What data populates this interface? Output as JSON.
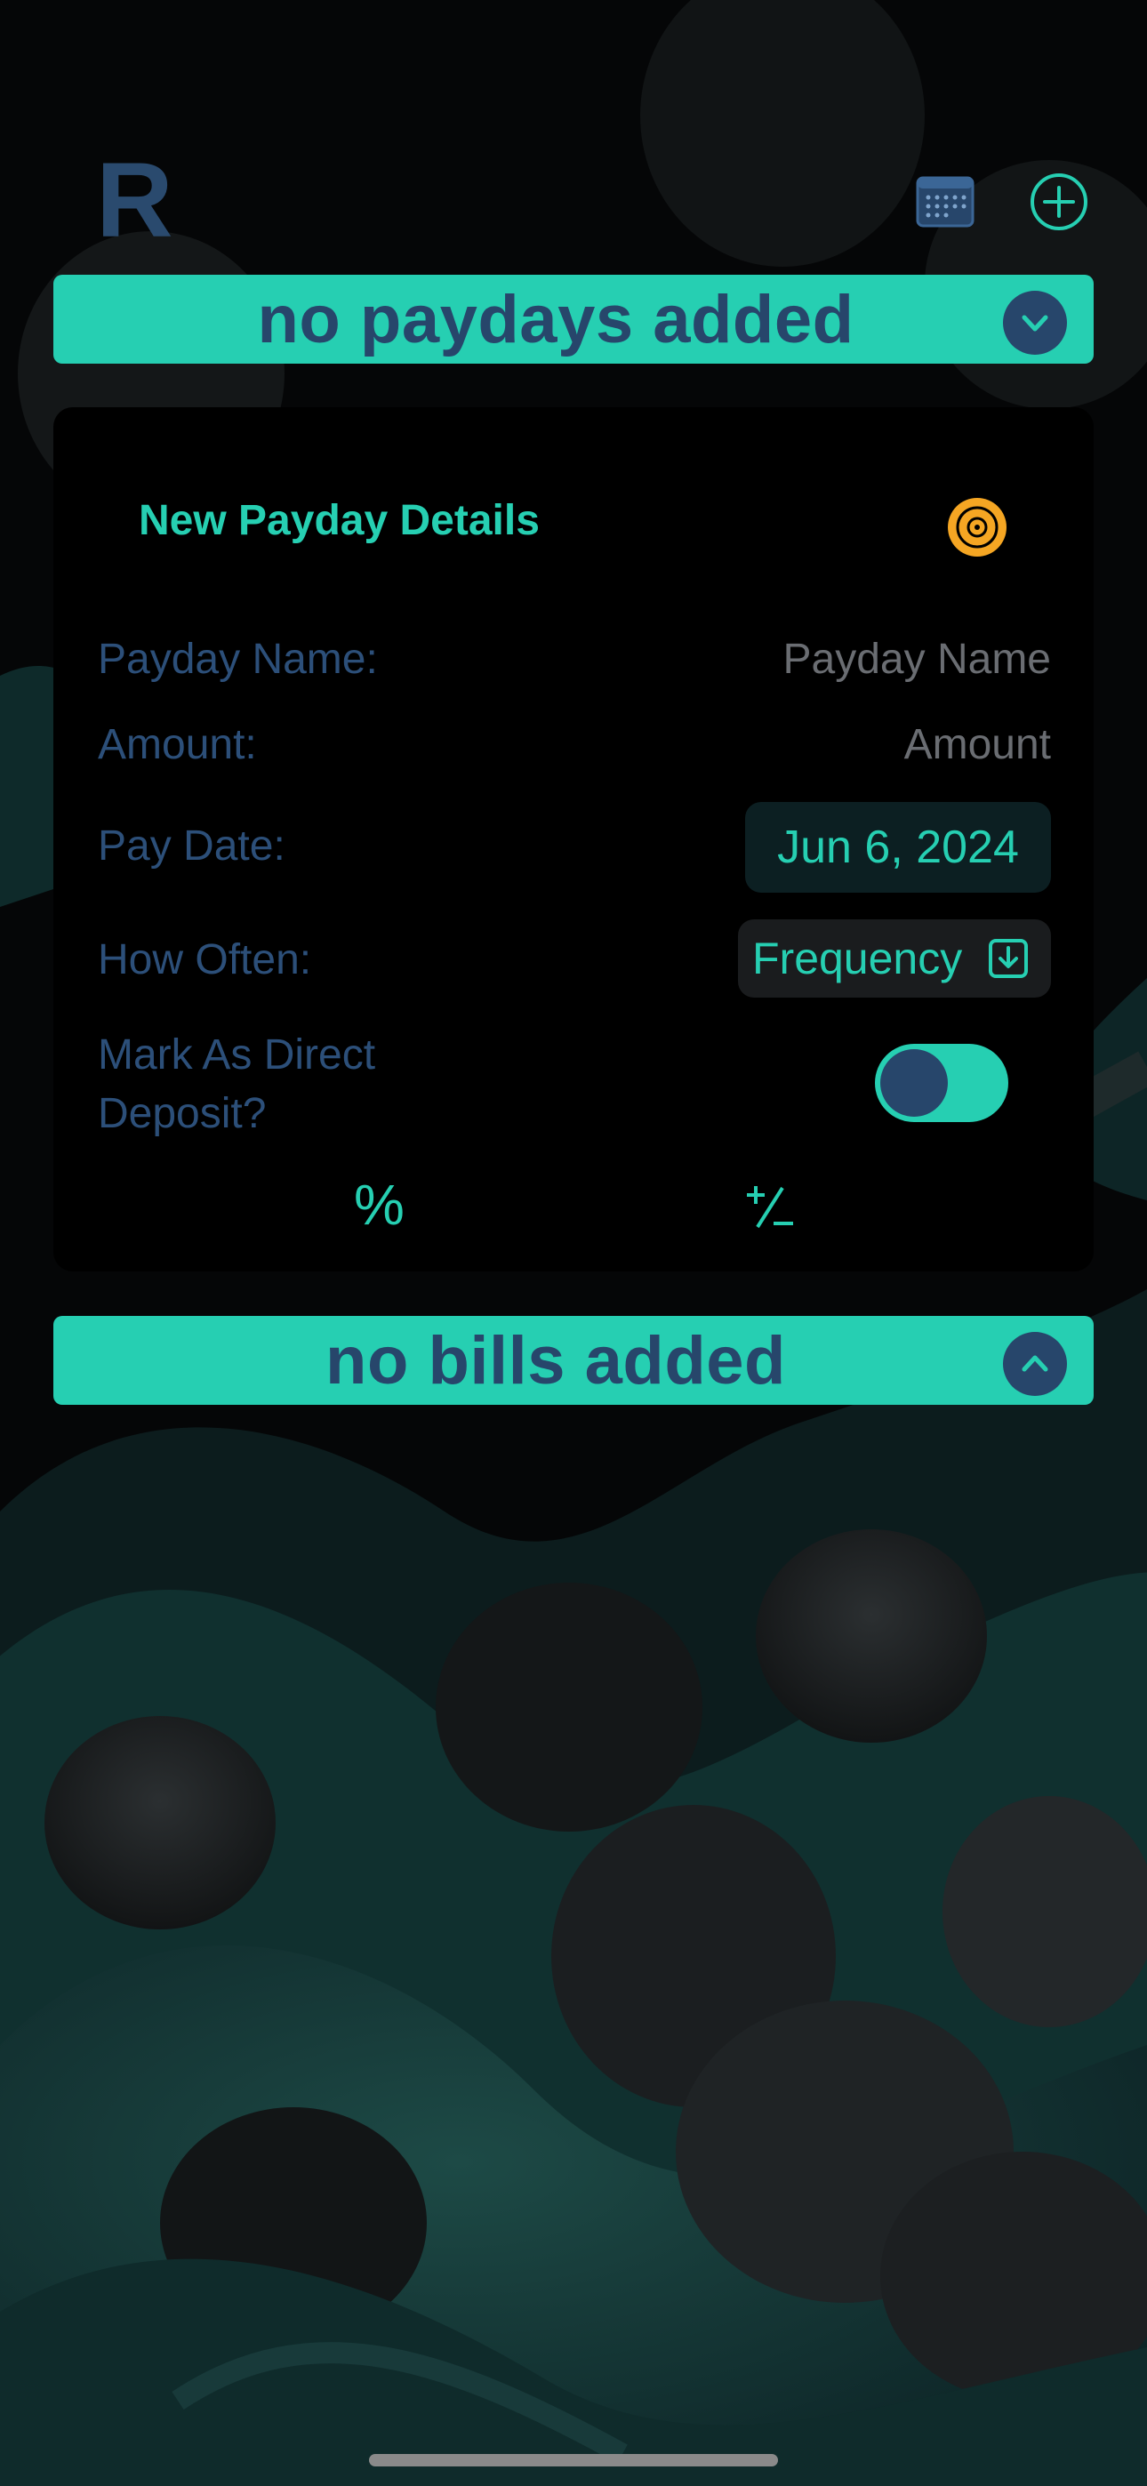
{
  "header": {
    "logo_letter": "R",
    "calendar_icon": "calendar-icon",
    "add_icon": "plus-circle-icon"
  },
  "paydays_banner": {
    "text": "no paydays added",
    "toggle_icon": "chevron-down-icon"
  },
  "payday_form": {
    "title": "New Payday Details",
    "save_icon": "disc-save-icon",
    "fields": {
      "name_label": "Payday Name:",
      "name_placeholder": "Payday Name",
      "amount_label": "Amount:",
      "amount_placeholder": "Amount",
      "pay_date_label": "Pay Date:",
      "pay_date_value": "Jun 6, 2024",
      "how_often_label": "How Often:",
      "frequency_value": "Frequency",
      "frequency_icon": "download-box-icon",
      "direct_deposit_label_line1": "Mark As Direct",
      "direct_deposit_label_line2": "Deposit?",
      "direct_deposit_on": true
    },
    "percent_symbol": "%",
    "plus_minus_symbol": "+/-"
  },
  "bills_banner": {
    "text": "no bills added",
    "toggle_icon": "chevron-up-icon"
  },
  "colors": {
    "accent": "#26cfb2",
    "navy": "#27466b",
    "label": "#2c4f79",
    "placeholder": "#6a6d72",
    "orange": "#f5a623",
    "background": "#050607"
  }
}
